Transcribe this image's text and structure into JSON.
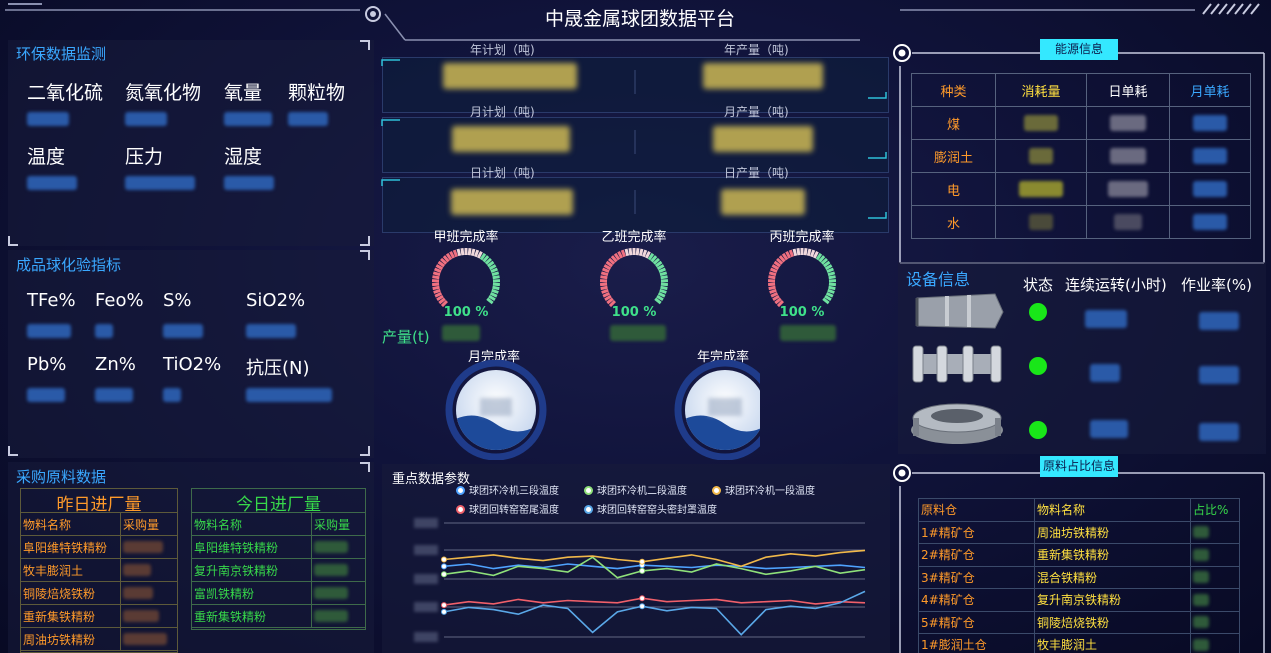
{
  "header": {
    "title": "中晟金属球团数据平台"
  },
  "env": {
    "title": "环保数据监测",
    "labels": [
      "二氧化硫",
      "氮氧化物",
      "氧量",
      "颗粒物",
      "温度",
      "压力",
      "湿度"
    ]
  },
  "quality": {
    "title": "成品球化验指标",
    "labels": [
      "TFe%",
      "Feo%",
      "S%",
      "SiO2%",
      "Pb%",
      "Zn%",
      "TiO2%",
      "抗压(N)"
    ]
  },
  "purchase": {
    "title": "采购原料数据",
    "yesterday": {
      "title": "昨日进厂量",
      "col_name": "物料名称",
      "col_amount": "采购量",
      "items": [
        "阜阳维特铁精粉",
        "牧丰膨润土",
        "铜陵焙烧铁粉",
        "重新集铁精粉",
        "周油坊铁精粉"
      ]
    },
    "today": {
      "title": "今日进厂量",
      "col_name": "物料名称",
      "col_amount": "采购量",
      "items": [
        "阜阳维特铁精粉",
        "复升南京铁精粉",
        "富凯铁精粉",
        "重新集铁精粉"
      ]
    }
  },
  "plan": {
    "year_plan": "年计划（吨)",
    "year_output": "年产量（吨)",
    "month_plan": "月计划（吨)",
    "month_output": "月产量（吨)",
    "day_plan": "日计划（吨)",
    "day_output": "日产量（吨)"
  },
  "shifts": [
    {
      "title": "甲班完成率",
      "pct": "100 %",
      "value": 1.0
    },
    {
      "title": "乙班完成率",
      "pct": "100 %",
      "value": 1.0
    },
    {
      "title": "丙班完成率",
      "pct": "100 %",
      "value": 1.0
    }
  ],
  "output_label": "产量(t)",
  "completion": {
    "month": "月完成率",
    "year": "年完成率"
  },
  "params": {
    "title": "重点数据参数",
    "legend": [
      {
        "name": "球团环冷机三段温度",
        "color": "#4fa3ff"
      },
      {
        "name": "球团环冷机二段温度",
        "color": "#8fe07a"
      },
      {
        "name": "球团环冷机一段温度",
        "color": "#f0b84a"
      },
      {
        "name": "球团回转窑窑尾温度",
        "color": "#f0606a"
      },
      {
        "name": "球团回转窑窑头密封罩温度",
        "color": "#5aa8e8"
      }
    ]
  },
  "energy": {
    "title": "能源信息",
    "headers": [
      "种类",
      "消耗量",
      "日单耗",
      "月单耗"
    ],
    "header_colors": [
      "#ff9a2a",
      "#ffe040",
      "#ffffff",
      "#3aa8ff"
    ],
    "rows": [
      "煤",
      "膨润土",
      "电",
      "水"
    ]
  },
  "equipment": {
    "title": "设备信息",
    "col_status": "状态",
    "col_run": "连续运转(小时)",
    "col_rate": "作业率(%)",
    "status_color": "#19e619"
  },
  "ratio": {
    "title": "原料占比信息",
    "headers": [
      "原料仓",
      "物料名称",
      "占比%"
    ],
    "rows": [
      [
        "1#精矿仓",
        "周油坊铁精粉"
      ],
      [
        "2#精矿仓",
        "重新集铁精粉"
      ],
      [
        "3#精矿仓",
        "混合铁精粉"
      ],
      [
        "4#精矿仓",
        "复升南京铁精粉"
      ],
      [
        "5#精矿仓",
        "铜陵焙烧铁粉"
      ],
      [
        "1#膨润土仓",
        "牧丰膨润土"
      ]
    ]
  },
  "chart_data": {
    "type": "line",
    "title": "重点数据参数",
    "xlabel": "",
    "ylabel": "",
    "series": [
      {
        "name": "球团环冷机三段温度",
        "values": [
          0.62,
          0.64,
          0.6,
          0.63,
          0.61,
          0.64,
          0.62,
          0.6,
          0.63,
          0.62,
          0.61,
          0.63,
          0.62,
          0.6,
          0.61,
          0.62,
          0.63,
          0.61
        ]
      },
      {
        "name": "球团环冷机二段温度",
        "values": [
          0.55,
          0.58,
          0.54,
          0.62,
          0.6,
          0.57,
          0.7,
          0.52,
          0.58,
          0.6,
          0.57,
          0.64,
          0.6,
          0.55,
          0.58,
          0.62,
          0.56,
          0.59
        ]
      },
      {
        "name": "球团环冷机一段温度",
        "values": [
          0.68,
          0.7,
          0.72,
          0.69,
          0.67,
          0.7,
          0.71,
          0.68,
          0.66,
          0.69,
          0.72,
          0.68,
          0.62,
          0.7,
          0.73,
          0.71,
          0.74,
          0.76
        ]
      },
      {
        "name": "球团回转窑窑尾温度",
        "values": [
          0.28,
          0.31,
          0.29,
          0.33,
          0.3,
          0.32,
          0.31,
          0.3,
          0.34,
          0.31,
          0.32,
          0.33,
          0.3,
          0.31,
          0.32,
          0.29,
          0.31,
          0.3
        ]
      },
      {
        "name": "球团回转窑窑头密封罩温度",
        "values": [
          0.22,
          0.26,
          0.24,
          0.2,
          0.28,
          0.25,
          0.04,
          0.22,
          0.27,
          0.23,
          0.26,
          0.25,
          0.02,
          0.24,
          0.27,
          0.25,
          0.3,
          0.4
        ]
      }
    ]
  }
}
